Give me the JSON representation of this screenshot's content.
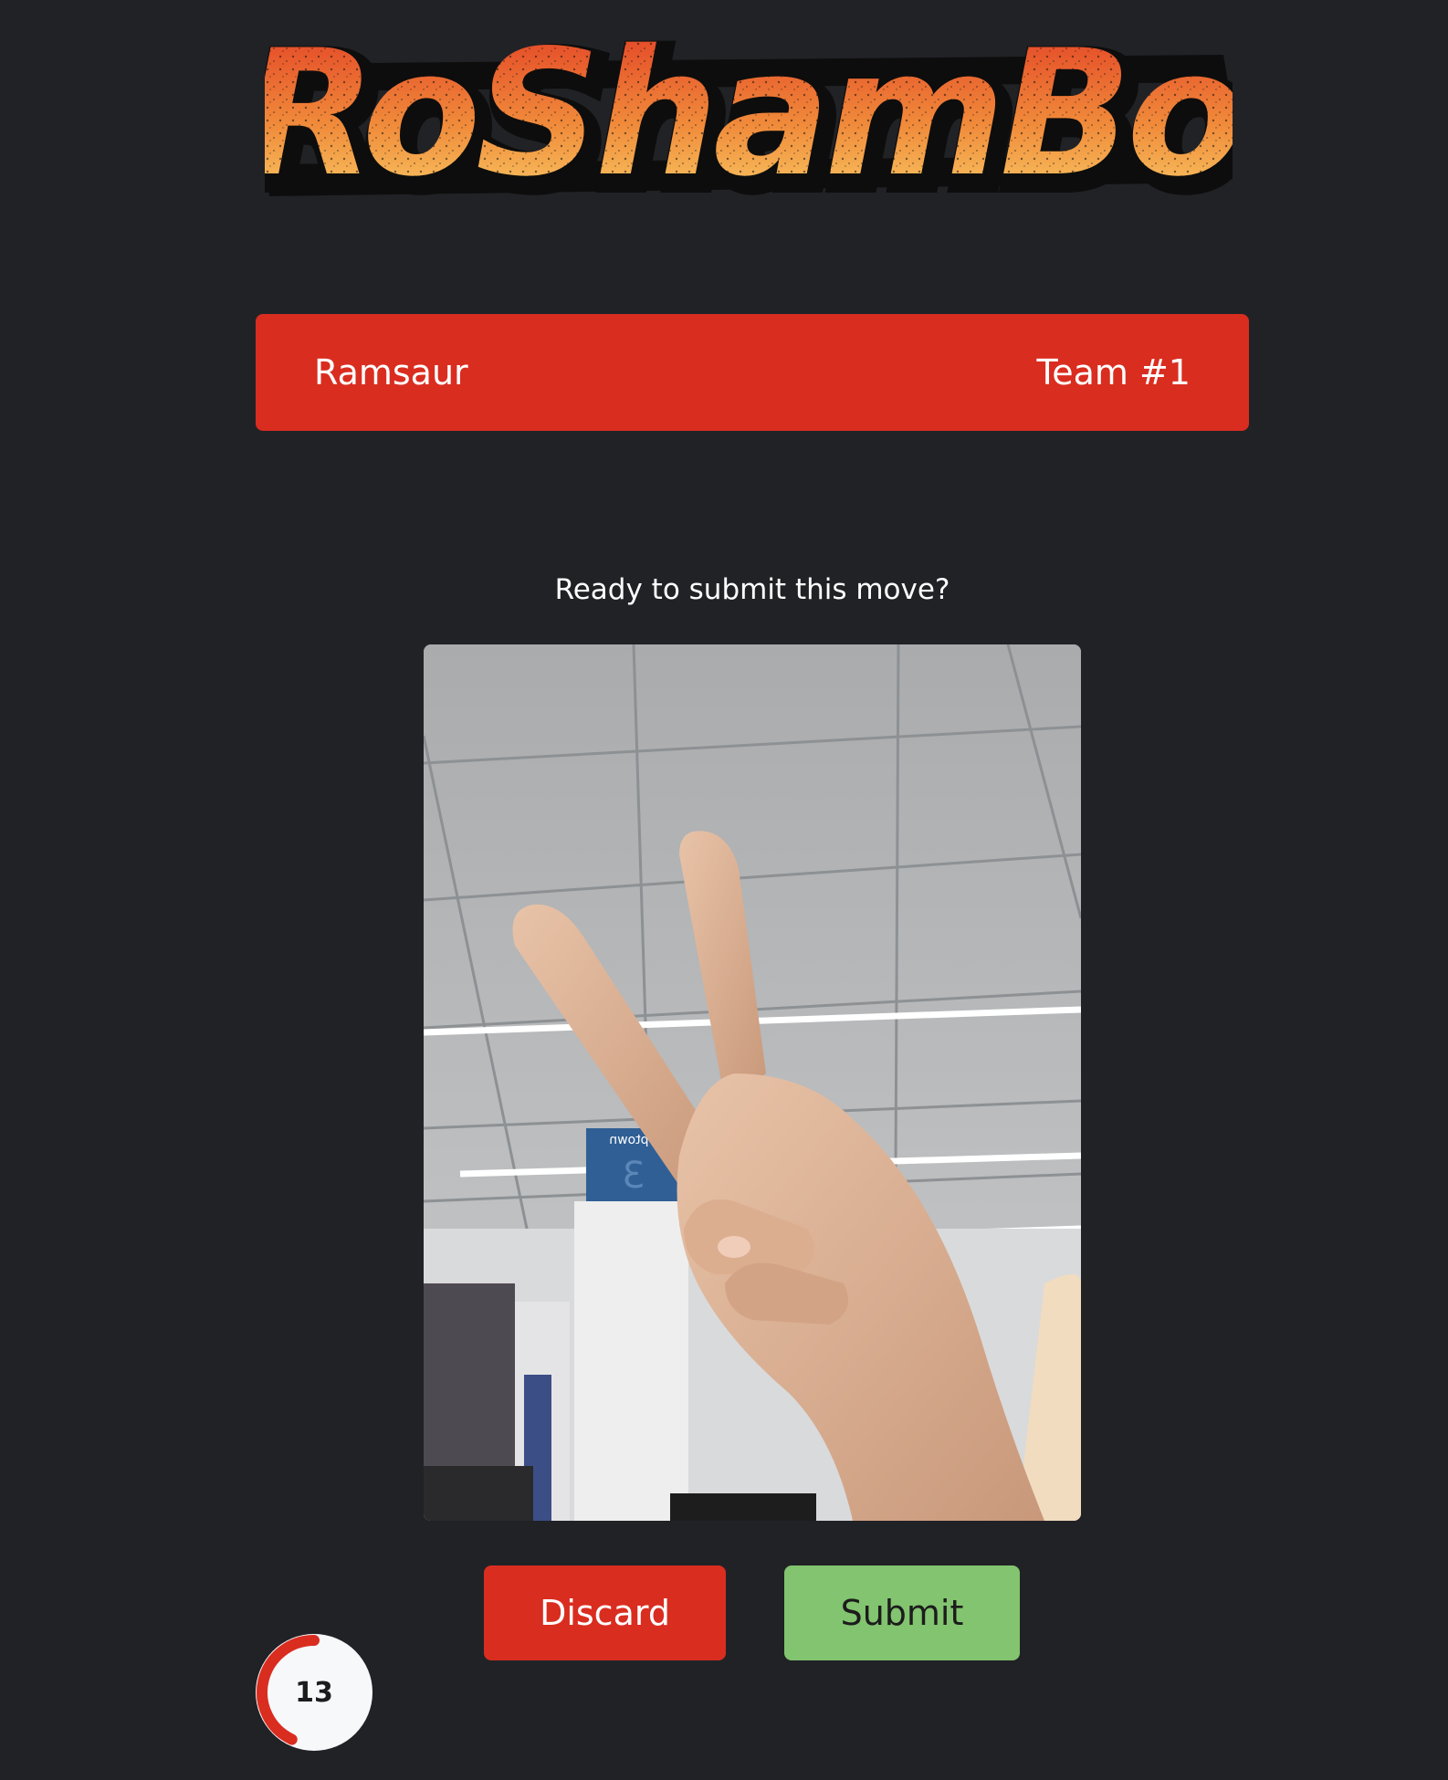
{
  "app": {
    "logo_text": "RoShamBo"
  },
  "player": {
    "name": "Ramsaur",
    "team": "Team #1"
  },
  "prompt": "Ready to submit this move?",
  "photo": {
    "description_icon": "peace-sign-hand-photo",
    "sign_text": "Uptown",
    "sign_number": "3"
  },
  "actions": {
    "discard_label": "Discard",
    "submit_label": "Submit"
  },
  "timer": {
    "value": "13",
    "fraction_remaining": 0.43
  },
  "colors": {
    "background": "#212226",
    "accent_red": "#d92d20",
    "submit_green": "#82c46f",
    "timer_bg": "#f7f8fa"
  }
}
